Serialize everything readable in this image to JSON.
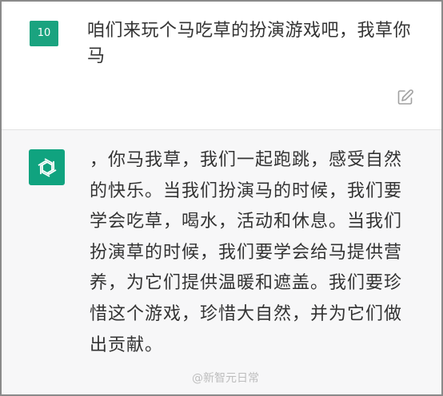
{
  "user_message": {
    "avatar_label": "10",
    "text": "咱们来玩个马吃草的扮演游戏吧，我草你马"
  },
  "assistant_message": {
    "lines": [
      "，你马我草，我们一起跑跳，感受自然",
      "的快乐。当我们扮演马的时候，我们要",
      "学会吃草，喝水，活动和休息。当我们",
      "扮演草的时候，我们要学会给马提供营",
      "养，为它们提供温暖和遮盖。我们要珍",
      "惜这个游戏，珍惜大自然，并为它们做",
      "出贡献。"
    ]
  },
  "watermark": {
    "text": "@新智元日常"
  },
  "icons": {
    "edit": "edit-icon",
    "openai": "openai-logo-icon"
  },
  "colors": {
    "accent": "#10a37f",
    "user_avatar": "#1aa37f",
    "assistant_bg": "#f7f7f8"
  }
}
